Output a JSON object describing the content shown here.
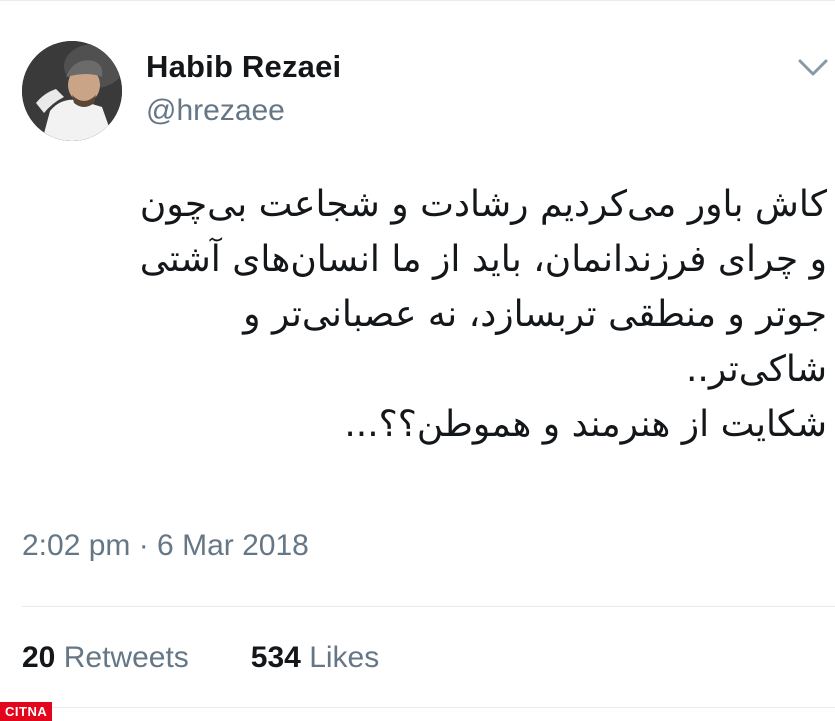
{
  "tweet": {
    "author_name": "Habib Rezaei",
    "author_handle": "@hrezaee",
    "text_lines": [
      "کاش باور می‌کردیم رشادت و شجاعت بی‌چون",
      "و چرای فرزندانمان، باید از ما انسان‌های آشتی",
      "جوتر و منطقی تربسازد، نه عصبانی‌تر و",
      "شاکی‌تر..",
      "شکایت از هنرمند و هموطن؟؟..."
    ],
    "timestamp": "2:02 pm · 6 Mar 2018",
    "retweets_count": "20",
    "retweets_label": "Retweets",
    "likes_count": "534",
    "likes_label": "Likes"
  },
  "icons": {
    "menu": "chevron-down-icon",
    "avatar": "user-avatar"
  },
  "watermark": "CITNA",
  "colors": {
    "primary_text": "#14171a",
    "secondary_text": "#657786",
    "divider": "#e6ecf0",
    "watermark_bg": "#e3051b"
  }
}
